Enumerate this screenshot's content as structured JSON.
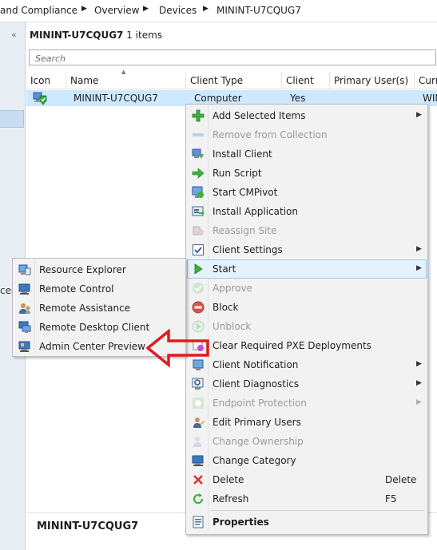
{
  "breadcrumb": {
    "items": [
      "and Compliance",
      "Overview",
      "Devices",
      "MININT-U7CQUG7"
    ],
    "separator": "▶"
  },
  "leftpane": {
    "collapse_glyph": "«",
    "partial_text": "ces"
  },
  "list": {
    "title_name": "MININT-U7CQUG7",
    "title_count": "1 items",
    "search_placeholder": "Search",
    "columns": [
      "Icon",
      "Name",
      "Client Type",
      "Client",
      "Primary User(s)",
      "Curr"
    ],
    "rows": [
      {
        "name": "MININT-U7CQUG7",
        "client_type": "Computer",
        "client": "Yes",
        "current": "WIN"
      }
    ]
  },
  "detail": {
    "title": "MININT-U7CQUG7"
  },
  "context_menu": {
    "items": [
      {
        "label": "Add Selected Items",
        "icon": "green-plus-icon",
        "submenu": true
      },
      {
        "label": "Remove from Collection",
        "icon": "remove-icon",
        "disabled": true
      },
      {
        "label": "Install Client",
        "icon": "install-client-icon"
      },
      {
        "label": "Run Script",
        "icon": "green-arrow-icon"
      },
      {
        "label": "Start CMPivot",
        "icon": "cmpivot-icon"
      },
      {
        "label": "Install Application",
        "icon": "install-app-icon"
      },
      {
        "label": "Reassign Site",
        "icon": "reassign-icon",
        "disabled": true
      },
      {
        "label": "Client Settings",
        "icon": "checkbox-icon",
        "submenu": true
      },
      {
        "label": "Start",
        "icon": "play-icon",
        "submenu": true,
        "highlighted": true
      },
      {
        "label": "Approve",
        "icon": "approve-icon",
        "disabled": true
      },
      {
        "label": "Block",
        "icon": "block-icon"
      },
      {
        "label": "Unblock",
        "icon": "unblock-icon",
        "disabled": true
      },
      {
        "label": "Clear Required PXE Deployments",
        "icon": "pxe-icon"
      },
      {
        "label": "Client Notification",
        "icon": "notification-icon",
        "submenu": true
      },
      {
        "label": "Client Diagnostics",
        "icon": "diagnostics-icon",
        "submenu": true
      },
      {
        "label": "Endpoint Protection",
        "icon": "shield-plus-icon",
        "submenu": true,
        "disabled": true
      },
      {
        "label": "Edit Primary Users",
        "icon": "users-icon"
      },
      {
        "label": "Change Ownership",
        "icon": "ownership-icon",
        "disabled": true
      },
      {
        "label": "Change Category",
        "icon": "category-icon"
      },
      {
        "label": "Delete",
        "icon": "delete-x-icon",
        "shortcut": "Delete"
      },
      {
        "label": "Refresh",
        "icon": "refresh-icon",
        "shortcut": "F5"
      },
      {
        "label": "Properties",
        "icon": "properties-icon",
        "bold": true
      }
    ]
  },
  "start_submenu": {
    "items": [
      {
        "label": "Resource Explorer",
        "icon": "resource-explorer-icon"
      },
      {
        "label": "Remote Control",
        "icon": "remote-control-icon"
      },
      {
        "label": "Remote Assistance",
        "icon": "remote-assistance-icon"
      },
      {
        "label": "Remote Desktop Client",
        "icon": "remote-desktop-icon"
      },
      {
        "label": "Admin Center Preview",
        "icon": "admin-center-icon"
      }
    ]
  },
  "colors": {
    "selection": "#cde8ff",
    "menu_bg": "#f2f2f2",
    "menu_hover": "#e5f1fb",
    "arrow_red": "#e01b1b",
    "disabled_text": "#9a9a9a"
  }
}
